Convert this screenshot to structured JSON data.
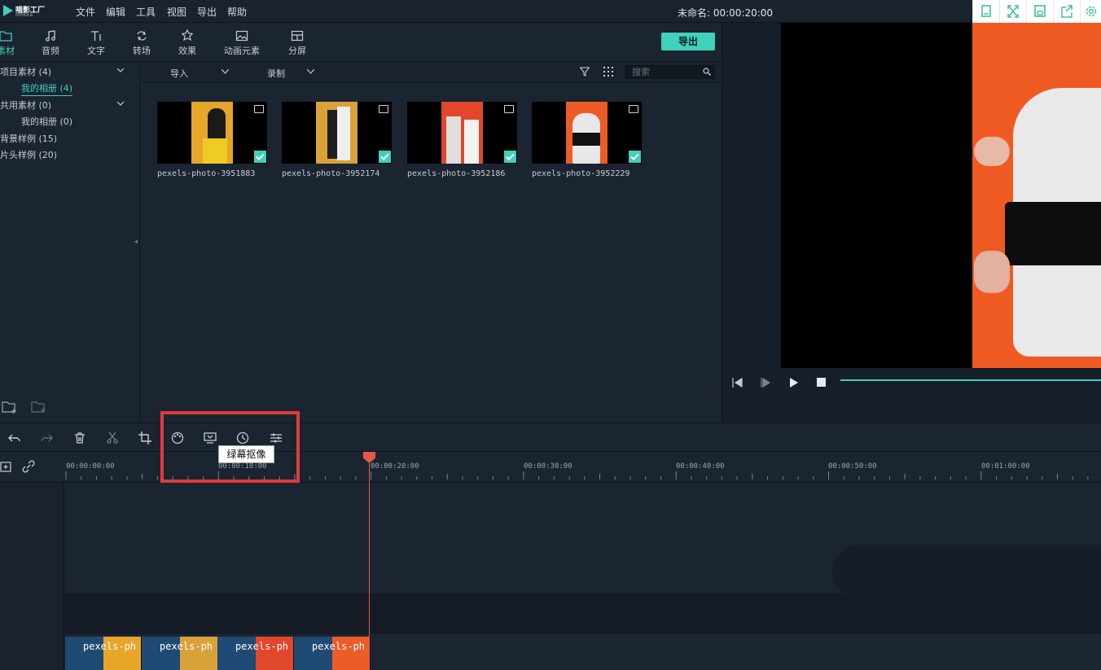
{
  "app": {
    "logo_title": "喵影工厂",
    "logo_sub": "filmora",
    "project_title": "未命名: 00:00:20:00"
  },
  "menu": [
    "文件",
    "编辑",
    "工具",
    "视图",
    "导出",
    "帮助"
  ],
  "window_buttons": [
    "bookmark-icon",
    "fullscreen-icon",
    "save-icon",
    "share-icon",
    "settings-icon"
  ],
  "toolbar": {
    "items": [
      "素材",
      "音频",
      "文字",
      "转场",
      "效果",
      "动画元素",
      "分屏"
    ],
    "active": "素材",
    "export_label": "导出"
  },
  "sidebar": {
    "items": [
      {
        "label": "项目素材 (4)",
        "caret": true
      },
      {
        "label": "我的相册 (4)",
        "sub": true,
        "selected": true
      },
      {
        "label": "共用素材 (0)",
        "caret": true
      },
      {
        "label": "我的相册 (0)",
        "sub": true
      },
      {
        "label": "背景样例 (15)"
      },
      {
        "label": "片头样例 (20)"
      }
    ]
  },
  "media": {
    "import_label": "导入",
    "record_label": "录制",
    "search_placeholder": "搜索",
    "files": [
      {
        "name": "pexels-photo-3951883",
        "bg": "#e7a52a"
      },
      {
        "name": "pexels-photo-3952174",
        "bg": "#d9a13a"
      },
      {
        "name": "pexels-photo-3952186",
        "bg": "#e1472b"
      },
      {
        "name": "pexels-photo-3952229",
        "bg": "#ec5c26"
      }
    ]
  },
  "tooltip": "绿幕抠像",
  "timeline": {
    "ticks": [
      "00:00:00:00",
      "00:00:10:00",
      "00:00:20:00",
      "00:00:30:00",
      "00:00:40:00",
      "00:00:50:00",
      "00:01:00:00"
    ],
    "clip_label": "pexels-ph"
  },
  "colors": {
    "accent": "#3fd1b9",
    "playhead": "#e5564a",
    "highlight_box": "#e23a3a"
  }
}
